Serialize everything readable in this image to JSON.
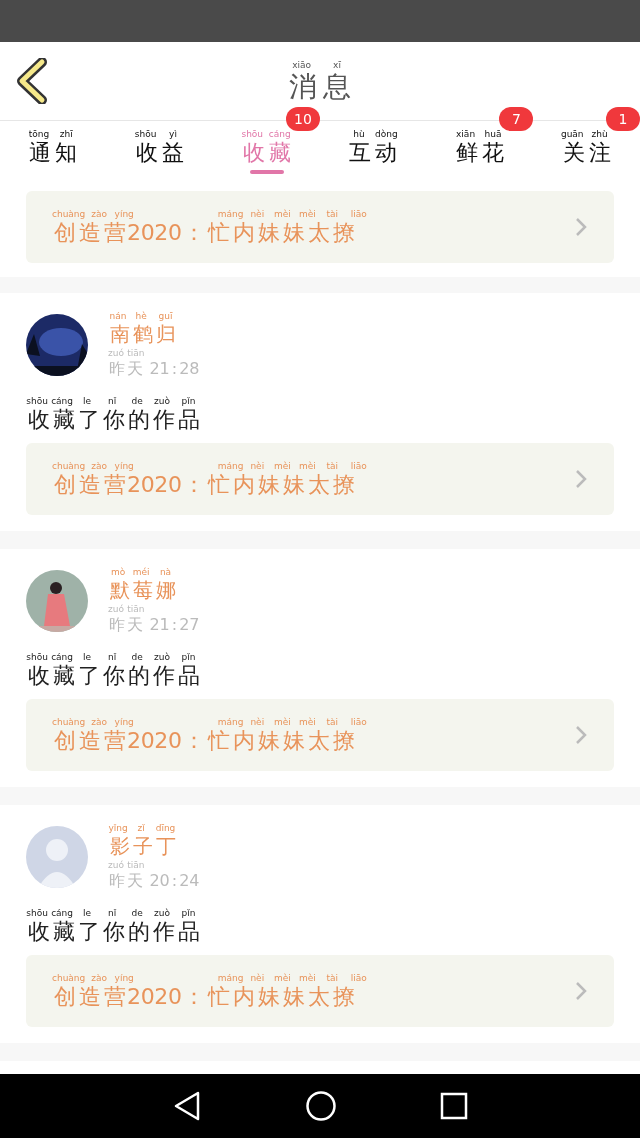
{
  "header": {
    "title": "消息",
    "title_pinyin": "xiāo xī"
  },
  "tabs": [
    {
      "label": "通知",
      "pinyin": "tōng zhī",
      "selected": false
    },
    {
      "label": "收益",
      "pinyin": "shōu yì",
      "selected": false
    },
    {
      "label": "收藏",
      "pinyin": "shōu cáng",
      "selected": true,
      "badge": "10"
    },
    {
      "label": "互动",
      "pinyin": "hù dòng",
      "selected": false
    },
    {
      "label": "鲜花",
      "pinyin": "xiān huā",
      "selected": false,
      "badge": "7"
    },
    {
      "label": "关注",
      "pinyin": "guān zhù",
      "selected": false,
      "badge": "1"
    }
  ],
  "top_article": {
    "title": "创造营2020：忙内妹妹太撩",
    "pinyin": "chuàng zào yíng máng nèi mèi mèi tài liāo"
  },
  "messages": [
    {
      "name": "南鹤归",
      "name_pinyin": "nán hè guī",
      "time": "昨天 21:28",
      "time_pinyin": "zuó tiān",
      "action": "收藏了你的作品",
      "action_pinyin": "shōu cáng le nǐ de zuò pǐn",
      "article": "创造营2020：忙内妹妹太撩",
      "article_pinyin": "chuàng zào yíng máng nèi mèi mèi tài liāo"
    },
    {
      "name": "默莓娜",
      "name_pinyin": "mò méi nà",
      "time": "昨天 21:27",
      "time_pinyin": "zuó tiān",
      "action": "收藏了你的作品",
      "action_pinyin": "shōu cáng le nǐ de zuò pǐn",
      "article": "创造营2020：忙内妹妹太撩",
      "article_pinyin": "chuàng zào yíng máng nèi mèi mèi tài liāo"
    },
    {
      "name": "影子丁",
      "name_pinyin": "yǐng zǐ dīng",
      "time": "昨天 20:24",
      "time_pinyin": "zuó tiān",
      "action": "收藏了你的作品",
      "action_pinyin": "shōu cáng le nǐ de zuò pǐn",
      "article": "创造营2020：忙内妹妹太撩",
      "article_pinyin": "chuàng zào yíng máng nèi mèi mèi tài liāo"
    }
  ]
}
